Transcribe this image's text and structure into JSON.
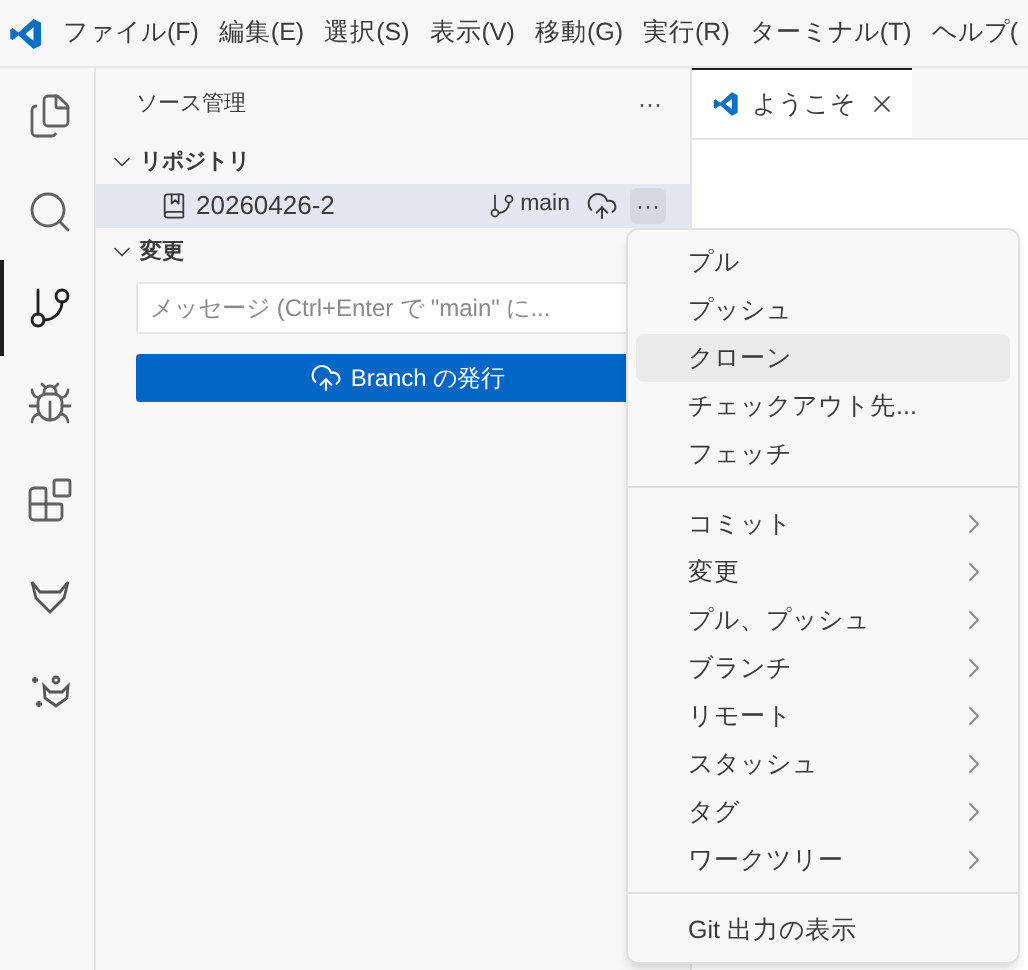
{
  "menu_bar": [
    "ファイル(F)",
    "編集(E)",
    "選択(S)",
    "表示(V)",
    "移動(G)",
    "実行(R)",
    "ターミナル(T)",
    "ヘルプ("
  ],
  "activity_bar": [
    {
      "kind": "files",
      "selected": false
    },
    {
      "kind": "search",
      "selected": false
    },
    {
      "kind": "source-control",
      "selected": true
    },
    {
      "kind": "run",
      "selected": false
    },
    {
      "kind": "extensions",
      "selected": false
    },
    {
      "kind": "fox",
      "selected": false
    },
    {
      "kind": "sparkle-fox",
      "selected": false
    }
  ],
  "sidebar": {
    "title": "ソース管理",
    "more": "···",
    "repositories": {
      "label": "リポジトリ",
      "expanded": true,
      "repo": {
        "name": "20260426-2",
        "branch": "main",
        "more": "···"
      }
    },
    "changes": {
      "label": "変更",
      "expanded": true,
      "placeholder": "メッセージ (Ctrl+Enter で \"main\" に...",
      "publish_button": "Branch の発行"
    }
  },
  "editor_tabs": [
    {
      "label": "ようこそ",
      "selected": true
    }
  ],
  "context_menu": [
    [
      {
        "label": "プル",
        "submenu": false,
        "selected": false
      },
      {
        "label": "プッシュ",
        "submenu": false,
        "selected": false
      },
      {
        "label": "クローン",
        "submenu": false,
        "selected": true
      },
      {
        "label": "チェックアウト先...",
        "submenu": false,
        "selected": false
      },
      {
        "label": "フェッチ",
        "submenu": false,
        "selected": false
      }
    ],
    [
      {
        "label": "コミット",
        "submenu": true,
        "selected": false
      },
      {
        "label": "変更",
        "submenu": true,
        "selected": false
      },
      {
        "label": "プル、プッシュ",
        "submenu": true,
        "selected": false
      },
      {
        "label": "ブランチ",
        "submenu": true,
        "selected": false
      },
      {
        "label": "リモート",
        "submenu": true,
        "selected": false
      },
      {
        "label": "スタッシュ",
        "submenu": true,
        "selected": false
      },
      {
        "label": "タグ",
        "submenu": true,
        "selected": false
      },
      {
        "label": "ワークツリー",
        "submenu": true,
        "selected": false
      }
    ],
    [
      {
        "label": "Git 出力の表示",
        "submenu": false,
        "selected": false
      }
    ]
  ]
}
